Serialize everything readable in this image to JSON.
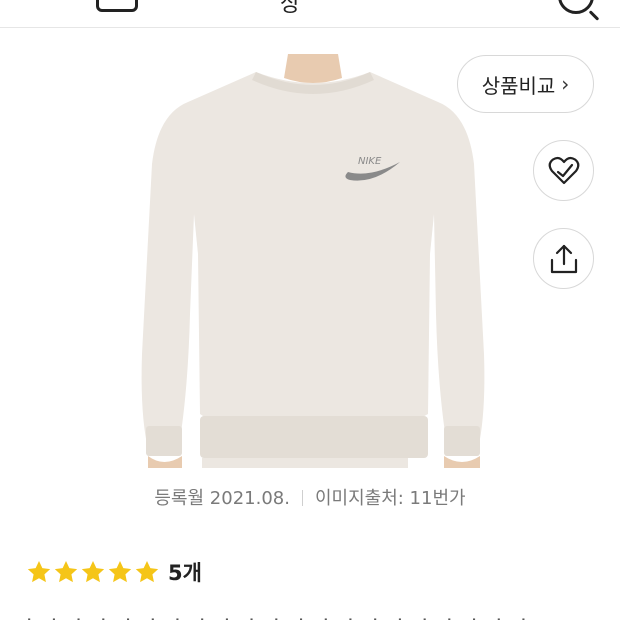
{
  "header": {
    "title": "상 ",
    "menu_icon": "hamburger-menu-icon",
    "cart_icon": "cart-icon",
    "search_icon": "search-icon"
  },
  "product": {
    "image_icon": "crewneck-sweatshirt-image",
    "registered": "등록월 2021.08.",
    "image_source": "이미지출처: 11번가"
  },
  "actions": {
    "compare_label": "상품비교",
    "compare_chevron": "›",
    "wishlist_icon": "heart-check-icon",
    "share_icon": "share-icon"
  },
  "rating": {
    "stars": 5,
    "count_label": "5개",
    "star_color": "#F5C518"
  }
}
